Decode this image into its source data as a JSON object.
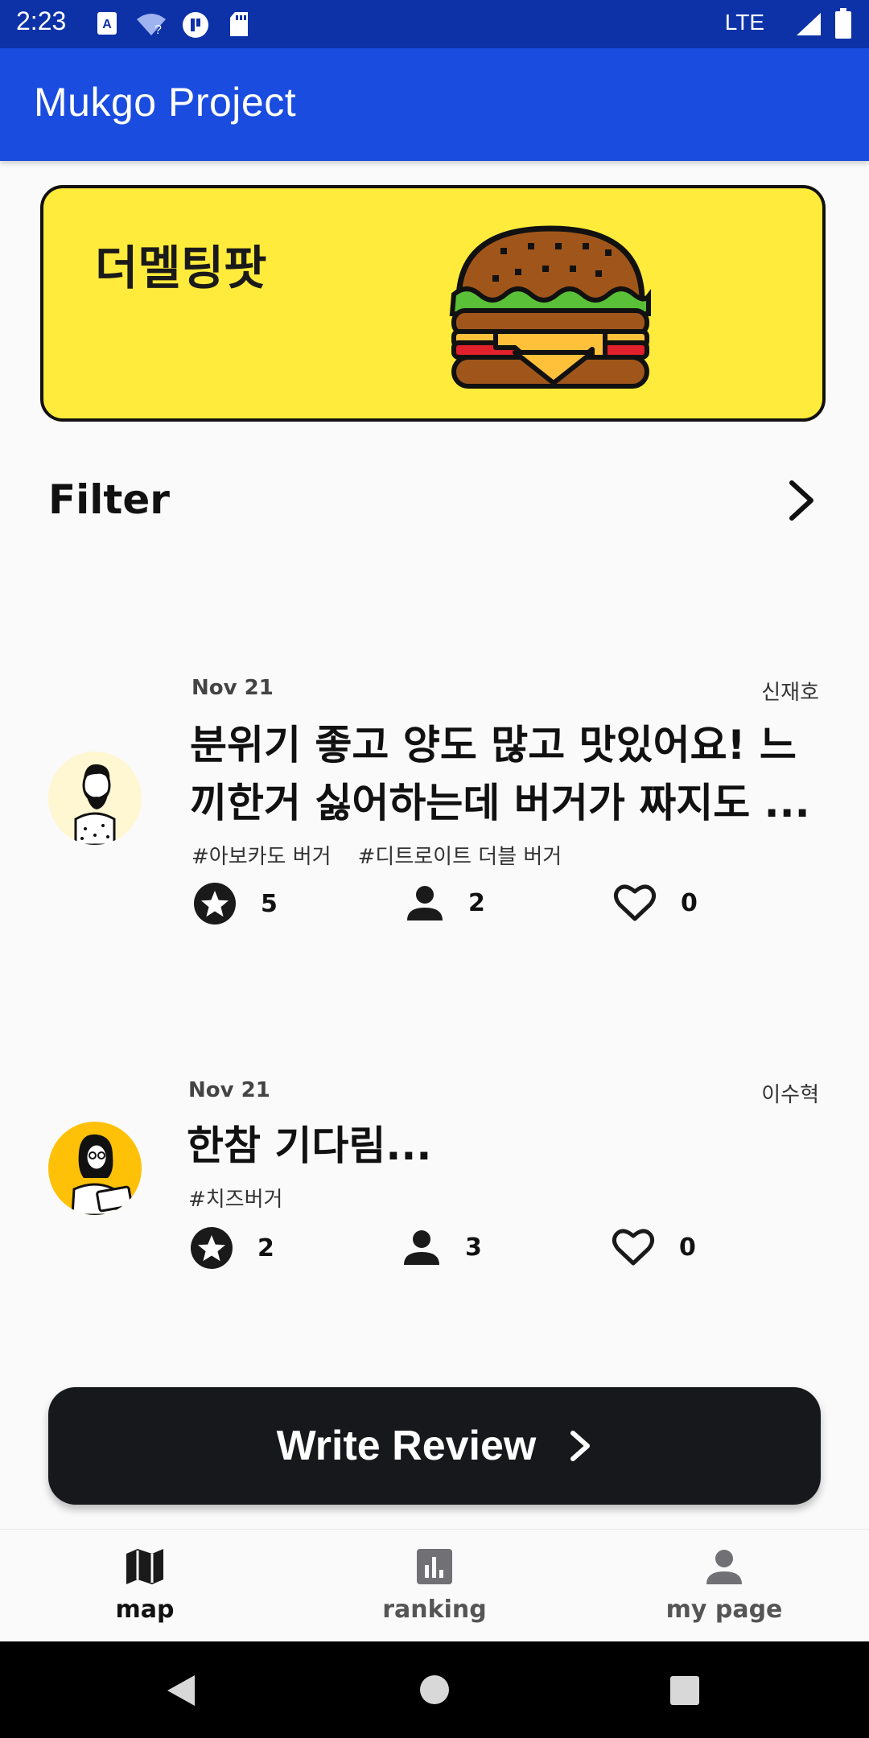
{
  "status_bar": {
    "time": "2:23",
    "network": "LTE"
  },
  "app_bar": {
    "title": "Mukgo Project"
  },
  "restaurant": {
    "name": "더멜팅팟"
  },
  "filter": {
    "label": "Filter"
  },
  "reviews": [
    {
      "date": "Nov 21",
      "author": "신재호",
      "body": "분위기 좋고 양도 많고 맛있어요! 느끼한거 싫어하는데 버거가 짜지도 ...",
      "tags": "#아보카도 버거    #디트로이트 더블 버거",
      "rating": "5",
      "people": "2",
      "likes": "0"
    },
    {
      "date": "Nov 21",
      "author": "이수혁",
      "body": "한참 기다림...",
      "tags": "#치즈버거",
      "rating": "2",
      "people": "3",
      "likes": "0"
    }
  ],
  "write_button": {
    "label": "Write Review"
  },
  "bottom_nav": {
    "items": [
      {
        "label": "map"
      },
      {
        "label": "ranking"
      },
      {
        "label": "my page"
      }
    ]
  },
  "colors": {
    "primary": "#1b4ce0",
    "status_bar": "#0d32a8",
    "banner": "#ffeb3b",
    "button": "#17181b"
  }
}
